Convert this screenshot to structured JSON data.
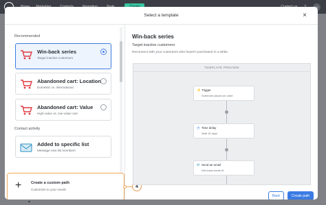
{
  "nav": {
    "items": [
      "Home",
      "Marketing",
      "Contacts",
      "Reporting",
      "Tools"
    ],
    "has_chevron": [
      false,
      true,
      true,
      true,
      true
    ],
    "create_label": "Create",
    "contact_us": "Contact us",
    "avatar_initials": "LC"
  },
  "modal": {
    "title": "Select a template",
    "close_icon": "close-icon"
  },
  "left": {
    "section_recommended": "Recommended",
    "section_contact_activity": "Contact activity",
    "cards": [
      {
        "title": "Win-back series",
        "subtitle": "Target inactive customers",
        "icon": "cart-icon",
        "selected": true
      },
      {
        "title": "Abandoned cart: Location",
        "subtitle": "Domestic vs. international",
        "icon": "cart-icon",
        "selected": false
      },
      {
        "title": "Abandoned cart: Value",
        "subtitle": "High-value vs. low-value cart",
        "icon": "cart-icon",
        "selected": false
      },
      {
        "title": "Added to specific list",
        "subtitle": "Message new list members",
        "icon": "envelope-icon",
        "selected": false
      }
    ],
    "custom_path": {
      "title": "Create a custom path",
      "subtitle": "Customize to your needs"
    },
    "callout_number": "4"
  },
  "right": {
    "title": "Win-back series",
    "subtitle": "Target inactive customers",
    "description": "Reconnect with your customers who haven't purchased in a while.",
    "preview_label": "TEMPLATE PREVIEW",
    "steps": [
      {
        "title": "Trigger",
        "subtitle": "Someone places an order",
        "icon": "bolt-icon"
      },
      {
        "title": "Time delay",
        "subtitle": "Wait 15 days",
        "icon": "clock-icon"
      },
      {
        "title": "Send an email",
        "subtitle": "Win-back email #1",
        "icon": "envelope-icon"
      }
    ]
  },
  "footer": {
    "back_label": "Back",
    "create_label": "Create path"
  },
  "colors": {
    "accent": "#3b7be3",
    "cart_red": "#e0393e",
    "callout": "#f2a65a",
    "nav_bg": "#3b3f45",
    "create_green": "#37c6a2"
  }
}
